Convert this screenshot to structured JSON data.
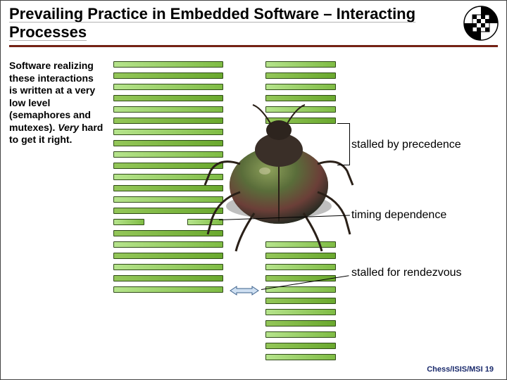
{
  "header": {
    "title": "Prevailing Practice in Embedded Software – Interacting Processes"
  },
  "body": {
    "text_pre": "Software realizing these interactions is written at a very low level (semaphores and mutexes). ",
    "text_emph": "Very",
    "text_post": " hard to get it right."
  },
  "annotations": {
    "a1": "stalled by precedence",
    "a2": "timing dependence",
    "a3": "stalled for rendezvous"
  },
  "footer": {
    "credit": "Chess/ISIS/MSI  19"
  },
  "logo": {
    "alt": "chess-logo"
  }
}
